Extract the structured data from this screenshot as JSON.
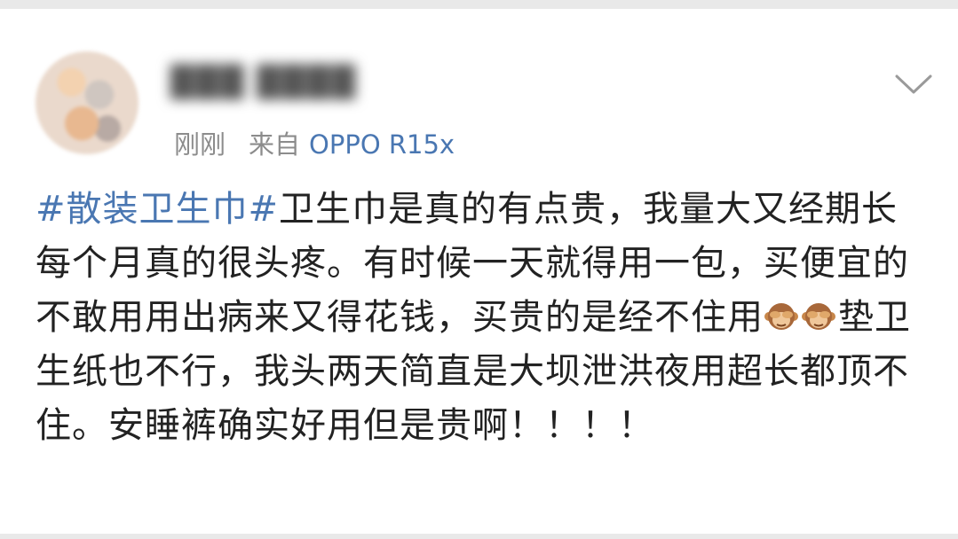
{
  "post": {
    "username": "███ ████",
    "time": "刚刚",
    "from_label": "来自",
    "device": "OPPO R15x",
    "hashtag": "#散装卫生巾#",
    "text_part1": "卫生巾是真的有点贵，我量大又经期长每个月真的很头疼。有时候一天就得用一包，买便宜的不敢用用出病来又得花钱，买贵的是经不住用",
    "emoji_count": 2,
    "emoji_icon": "see-no-evil-monkey-icon",
    "text_part2": "垫卫生纸也不行，我头两天简直是大坝泄洪夜用超长都顶不住。安睡裤确实好用但是贵啊！！！！"
  },
  "colors": {
    "link": "#4a77b2",
    "text": "#222222",
    "meta": "#8c8c8c",
    "background": "#ffffff"
  }
}
